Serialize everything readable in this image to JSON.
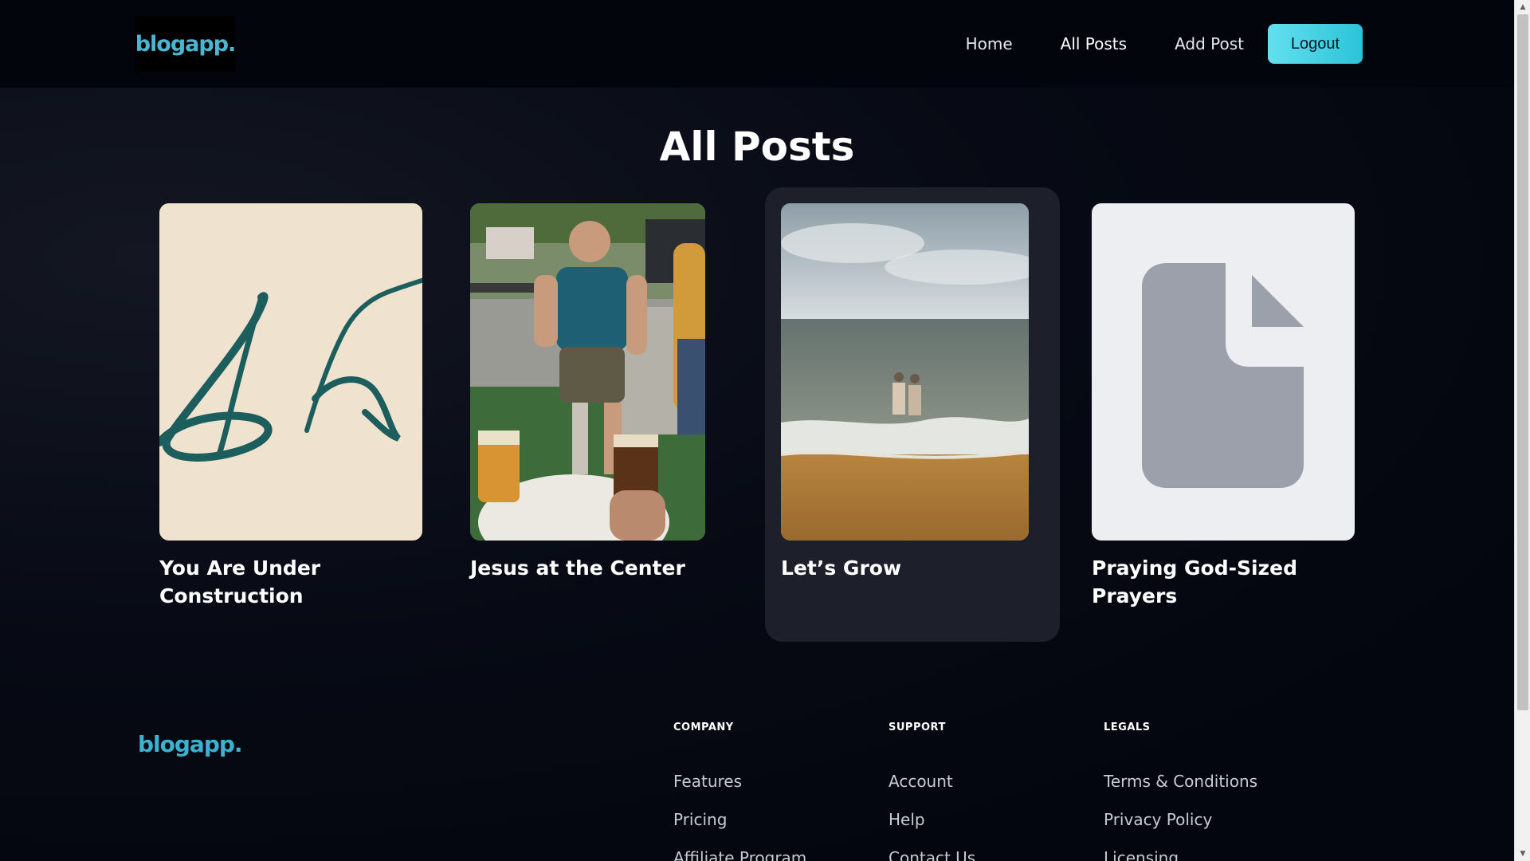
{
  "header": {
    "logo": "blogapp.",
    "nav": {
      "home": "Home",
      "all_posts": "All Posts",
      "add_post": "Add Post",
      "logout": "Logout"
    }
  },
  "main": {
    "title": "All Posts",
    "posts": [
      {
        "title_line1": "You Are Under",
        "title_line2": "Construction",
        "image": "letter-k-monogram-image"
      },
      {
        "title_line1": "Jesus at the Center",
        "title_line2": "",
        "image": "man-with-prosthetic-leg-photo"
      },
      {
        "title_line1": "Let’s Grow",
        "title_line2": "",
        "image": "beach-two-people-photo"
      },
      {
        "title_line1": "Praying God-Sized",
        "title_line2": "Prayers",
        "image": "document-placeholder-icon"
      }
    ]
  },
  "footer": {
    "logo": "blogapp.",
    "columns": [
      {
        "heading": "COMPANY",
        "links": [
          "Features",
          "Pricing",
          "Affiliate Program"
        ]
      },
      {
        "heading": "SUPPORT",
        "links": [
          "Account",
          "Help",
          "Contact Us"
        ]
      },
      {
        "heading": "LEGALS",
        "links": [
          "Terms & Conditions",
          "Privacy Policy",
          "Licensing"
        ]
      }
    ]
  },
  "colors": {
    "accent": "#49b7d2",
    "logout_button": "#3fd0e2",
    "background": "#04060f"
  }
}
